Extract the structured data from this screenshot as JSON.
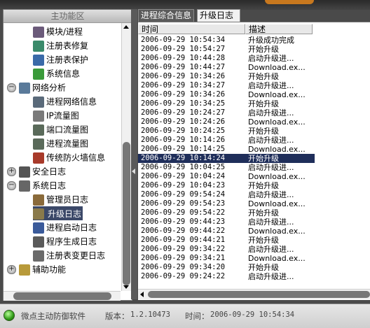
{
  "left_panel": {
    "header": "主功能区",
    "tree": [
      {
        "label": "模块/进程",
        "indent": 2,
        "icon": "module-process-icon",
        "color": "#6b5a7a"
      },
      {
        "label": "注册表修复",
        "indent": 2,
        "icon": "registry-repair-icon",
        "color": "#3a8a6a"
      },
      {
        "label": "注册表保护",
        "indent": 2,
        "icon": "registry-protect-icon",
        "color": "#3a6aa8"
      },
      {
        "label": "系统信息",
        "indent": 2,
        "icon": "system-info-icon",
        "color": "#3a9a3a"
      },
      {
        "label": "网络分析",
        "indent": 1,
        "icon": "network-analysis-icon",
        "color": "#5a7a9a",
        "expander": "minus"
      },
      {
        "label": "进程网络信息",
        "indent": 2,
        "icon": "process-network-icon",
        "color": "#5a6a7a"
      },
      {
        "label": "IP流量图",
        "indent": 2,
        "icon": "ip-traffic-icon",
        "color": "#7a7a7a"
      },
      {
        "label": "端口流量图",
        "indent": 2,
        "icon": "port-traffic-icon",
        "color": "#5a6a5a"
      },
      {
        "label": "进程流量图",
        "indent": 2,
        "icon": "process-traffic-icon",
        "color": "#5a6a5a"
      },
      {
        "label": "传统防火墙信息",
        "indent": 2,
        "icon": "firewall-icon",
        "color": "#a83a2a"
      },
      {
        "label": "安全日志",
        "indent": 1,
        "icon": "security-log-icon",
        "color": "#555",
        "expander": "plus"
      },
      {
        "label": "系统日志",
        "indent": 1,
        "icon": "system-log-icon",
        "color": "#666",
        "expander": "minus"
      },
      {
        "label": "管理员日志",
        "indent": 2,
        "icon": "admin-log-icon",
        "color": "#8a6a3a"
      },
      {
        "label": "升级日志",
        "indent": 2,
        "icon": "upgrade-log-icon",
        "color": "#8a7a4a",
        "selected": true
      },
      {
        "label": "进程启动日志",
        "indent": 2,
        "icon": "process-start-log-icon",
        "color": "#3a5a9a"
      },
      {
        "label": "程序生成日志",
        "indent": 2,
        "icon": "program-gen-log-icon",
        "color": "#5a5a5a"
      },
      {
        "label": "注册表变更日志",
        "indent": 2,
        "icon": "registry-change-log-icon",
        "color": "#6a6a6a"
      },
      {
        "label": "辅助功能",
        "indent": 1,
        "icon": "accessibility-icon",
        "color": "#b89a3a",
        "expander": "plus"
      }
    ]
  },
  "tabs": [
    {
      "label": "进程综合信息",
      "active": false
    },
    {
      "label": "升级日志",
      "active": true
    }
  ],
  "log": {
    "headers": {
      "time": "时间",
      "desc": "描述"
    },
    "rows": [
      {
        "time": "2006-09-29 10:54:34",
        "desc": "升级成功完成"
      },
      {
        "time": "2006-09-29 10:54:27",
        "desc": "开始升级"
      },
      {
        "time": "2006-09-29 10:44:28",
        "desc": "启动升级进..."
      },
      {
        "time": "2006-09-29 10:44:27",
        "desc": "Download.ex..."
      },
      {
        "time": "2006-09-29 10:34:26",
        "desc": "开始升级"
      },
      {
        "time": "2006-09-29 10:34:27",
        "desc": "启动升级进..."
      },
      {
        "time": "2006-09-29 10:34:26",
        "desc": "Download.ex..."
      },
      {
        "time": "2006-09-29 10:34:25",
        "desc": "开始升级"
      },
      {
        "time": "2006-09-29 10:24:27",
        "desc": "启动升级进..."
      },
      {
        "time": "2006-09-29 10:24:26",
        "desc": "Download.ex..."
      },
      {
        "time": "2006-09-29 10:24:25",
        "desc": "开始升级"
      },
      {
        "time": "2006-09-29 10:14:26",
        "desc": "启动升级进..."
      },
      {
        "time": "2006-09-29 10:14:25",
        "desc": "Download.ex..."
      },
      {
        "time": "2006-09-29 10:14:24",
        "desc": "开始升级",
        "selected": true
      },
      {
        "time": "2006-09-29 10:04:25",
        "desc": "启动升级进..."
      },
      {
        "time": "2006-09-29 10:04:24",
        "desc": "Download.ex..."
      },
      {
        "time": "2006-09-29 10:04:23",
        "desc": "开始升级"
      },
      {
        "time": "2006-09-29 09:54:24",
        "desc": "启动升级进..."
      },
      {
        "time": "2006-09-29 09:54:23",
        "desc": "Download.ex..."
      },
      {
        "time": "2006-09-29 09:54:22",
        "desc": "开始升级"
      },
      {
        "time": "2006-09-29 09:44:23",
        "desc": "启动升级进..."
      },
      {
        "time": "2006-09-29 09:44:22",
        "desc": "Download.ex..."
      },
      {
        "time": "2006-09-29 09:44:21",
        "desc": "开始升级"
      },
      {
        "time": "2006-09-29 09:34:22",
        "desc": "启动升级进..."
      },
      {
        "time": "2006-09-29 09:34:21",
        "desc": "Download.ex..."
      },
      {
        "time": "2006-09-29 09:34:20",
        "desc": "开始升级"
      },
      {
        "time": "2006-09-29 09:24:22",
        "desc": "启动升级进..."
      }
    ]
  },
  "status_bar": {
    "app_name": "微点主动防御软件",
    "version_label": "版本：",
    "version": "1.2.10473",
    "time_label": "时间：",
    "time": "2006-09-29 10:54:34"
  },
  "colors": {
    "selection": "#1f2e5a",
    "tree_selection": "#3b4868",
    "accent_orange": "#c8781e",
    "status_led": "#2e9a16"
  }
}
